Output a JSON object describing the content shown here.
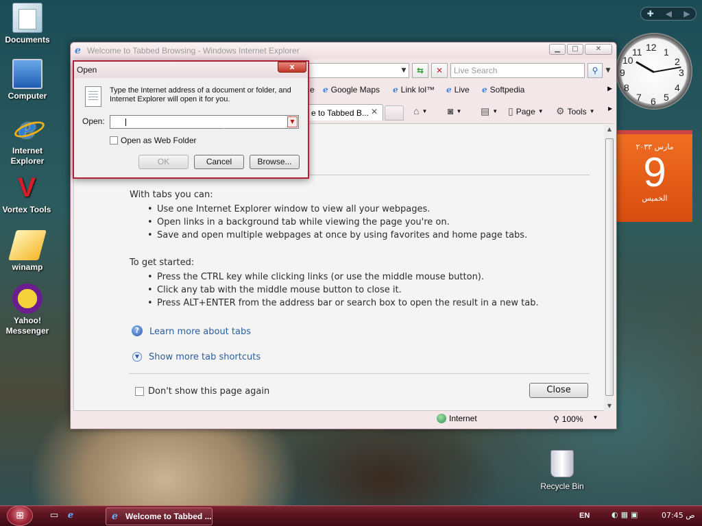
{
  "desktop": {
    "icons": [
      {
        "label": "Documents",
        "icon": "documents-folder-icon"
      },
      {
        "label": "Computer",
        "icon": "computer-icon"
      },
      {
        "label": "Internet\nExplorer",
        "label_line1": "Internet",
        "label_line2": "Explorer",
        "icon": "internet-explorer-icon"
      },
      {
        "label": "Vortex Tools",
        "icon": "vortex-tools-icon"
      },
      {
        "label": "winamp",
        "icon": "winamp-icon"
      },
      {
        "label_line1": "Yahoo!",
        "label_line2": "Messenger",
        "icon": "yahoo-messenger-icon"
      }
    ],
    "recycle_bin": "Recycle Bin"
  },
  "ie": {
    "title": "Welcome to Tabbed Browsing - Windows Internet Explorer",
    "search_placeholder": "Live Search",
    "favorites": [
      "Google Maps",
      "Link lol™",
      "Live",
      "Softpedia"
    ],
    "favorites_partial": "e",
    "tab_label": "e to Tabbed B...",
    "commands": {
      "page": "Page",
      "tools": "Tools"
    },
    "content": {
      "intro": "With tabs you can:",
      "bullets_a": [
        "Use one Internet Explorer window to view all your webpages.",
        "Open links in a background tab while viewing the page you're on.",
        "Save and open multiple webpages at once by using favorites and home page tabs."
      ],
      "get_started": "To get started:",
      "bullets_b": [
        "Press the CTRL key while clicking links (or use the middle mouse button).",
        "Click any tab with the middle mouse button to close it.",
        "Press ALT+ENTER from the address bar or search box to open the result in a new tab."
      ],
      "learn_more": "Learn more about tabs",
      "show_more": "Show more tab shortcuts",
      "dont_show": "Don't show this page again",
      "close": "Close"
    },
    "status": {
      "zone": "Internet",
      "zoom": "100%"
    }
  },
  "open_dialog": {
    "title": "Open",
    "close_glyph": "x",
    "description": "Type the Internet address of a document or folder, and Internet Explorer will open it for you.",
    "open_label": "Open:",
    "input_value": "",
    "web_folder_label": "Open as Web Folder",
    "ok": "OK",
    "cancel": "Cancel",
    "browse": "Browse..."
  },
  "gadgets": {
    "clock_numbers": [
      "12",
      "1",
      "2",
      "3",
      "4",
      "5",
      "6",
      "7",
      "8",
      "9",
      "10",
      "11"
    ],
    "calendar": {
      "month": "مارس ٢٠٣٣",
      "day": "9",
      "weekday": "الخميس"
    }
  },
  "taskbar": {
    "task_label": "Welcome to Tabbed ...",
    "language": "EN",
    "time": "07:45 ص"
  },
  "colors": {
    "taskbar": "#5a1420",
    "calendar": "#f06e22",
    "link": "#2b5d9e",
    "dialog_border": "#b32035"
  }
}
